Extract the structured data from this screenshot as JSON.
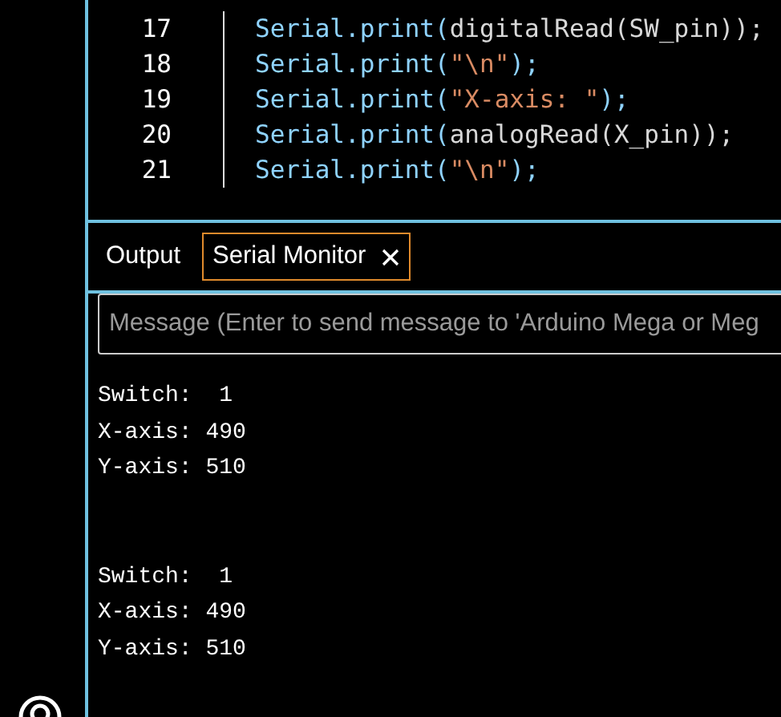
{
  "editor": {
    "lines": [
      {
        "number": "17",
        "tokens": [
          {
            "kind": "ident",
            "text": "Serial.print("
          },
          {
            "kind": "plain",
            "text": "digitalRead(SW_pin));"
          }
        ]
      },
      {
        "number": "18",
        "tokens": [
          {
            "kind": "ident",
            "text": "Serial.print("
          },
          {
            "kind": "string",
            "text": "\"\\n\""
          },
          {
            "kind": "ident",
            "text": ");"
          }
        ]
      },
      {
        "number": "19",
        "tokens": [
          {
            "kind": "ident",
            "text": "Serial.print("
          },
          {
            "kind": "string",
            "text": "\"X-axis: \""
          },
          {
            "kind": "ident",
            "text": ");"
          }
        ]
      },
      {
        "number": "20",
        "tokens": [
          {
            "kind": "ident",
            "text": "Serial.print("
          },
          {
            "kind": "plain",
            "text": "analogRead(X_pin));"
          }
        ]
      },
      {
        "number": "21",
        "tokens": [
          {
            "kind": "ident",
            "text": "Serial.print("
          },
          {
            "kind": "string",
            "text": "\"\\n\""
          },
          {
            "kind": "ident",
            "text": ");"
          }
        ]
      }
    ]
  },
  "panel": {
    "tabs": [
      {
        "label": "Output",
        "selected": false,
        "closable": false
      },
      {
        "label": "Serial Monitor",
        "selected": true,
        "closable": true
      }
    ],
    "message_field": {
      "placeholder": "Message (Enter to send message to 'Arduino Mega or Meg"
    },
    "output_blocks": [
      {
        "lines": [
          "Switch:  1",
          "X-axis: 490",
          "Y-axis: 510"
        ]
      },
      {
        "lines": [
          "Switch:  1",
          "X-axis: 490",
          "Y-axis: 510"
        ]
      }
    ]
  }
}
